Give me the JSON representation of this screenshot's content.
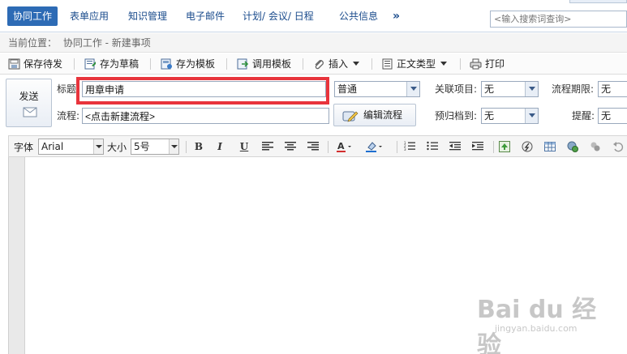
{
  "nav": {
    "tabs": [
      {
        "label": "协同工作",
        "active": true
      },
      {
        "label": "表单应用"
      },
      {
        "label": "知识管理"
      },
      {
        "label": "电子邮件"
      },
      {
        "label": "计划/ 会议/ 日程"
      },
      {
        "label": "公共信息"
      }
    ],
    "more": "»",
    "search_placeholder": "<输入搜索词查询>"
  },
  "breadcrumb": {
    "prefix": "当前位置：",
    "path": "协同工作 - 新建事项"
  },
  "toolbar": {
    "save_pending": "保存待发",
    "save_draft": "存为草稿",
    "save_template": "存为模板",
    "use_template": "调用模板",
    "insert": "插入",
    "body_type": "正文类型",
    "print": "打印"
  },
  "form": {
    "send_label": "发送",
    "title_label": "标题",
    "title_value": "用章申请",
    "importance_value": "普通",
    "related_label": "关联项目:",
    "related_value": "无",
    "deadline_label": "流程期限:",
    "deadline_value": "无",
    "flow_label": "流程:",
    "flow_value": "<点击新建流程>",
    "edit_flow_label": "编辑流程",
    "archive_label": "预归档到:",
    "archive_value": "无",
    "remind_label": "提醒:",
    "remind_value": "无"
  },
  "editor": {
    "font_label": "字体",
    "font_value": "Arial",
    "size_label": "大小",
    "size_value": "5号",
    "bold": "B",
    "italic": "I",
    "underline": "U"
  },
  "watermark": {
    "logo": "Bai du 经验",
    "url": "jingyan.baidu.com"
  },
  "colors": {
    "nav_active": "#2d6bb5",
    "nav_text": "#1a4b8c",
    "highlight_box": "#e8343c"
  }
}
